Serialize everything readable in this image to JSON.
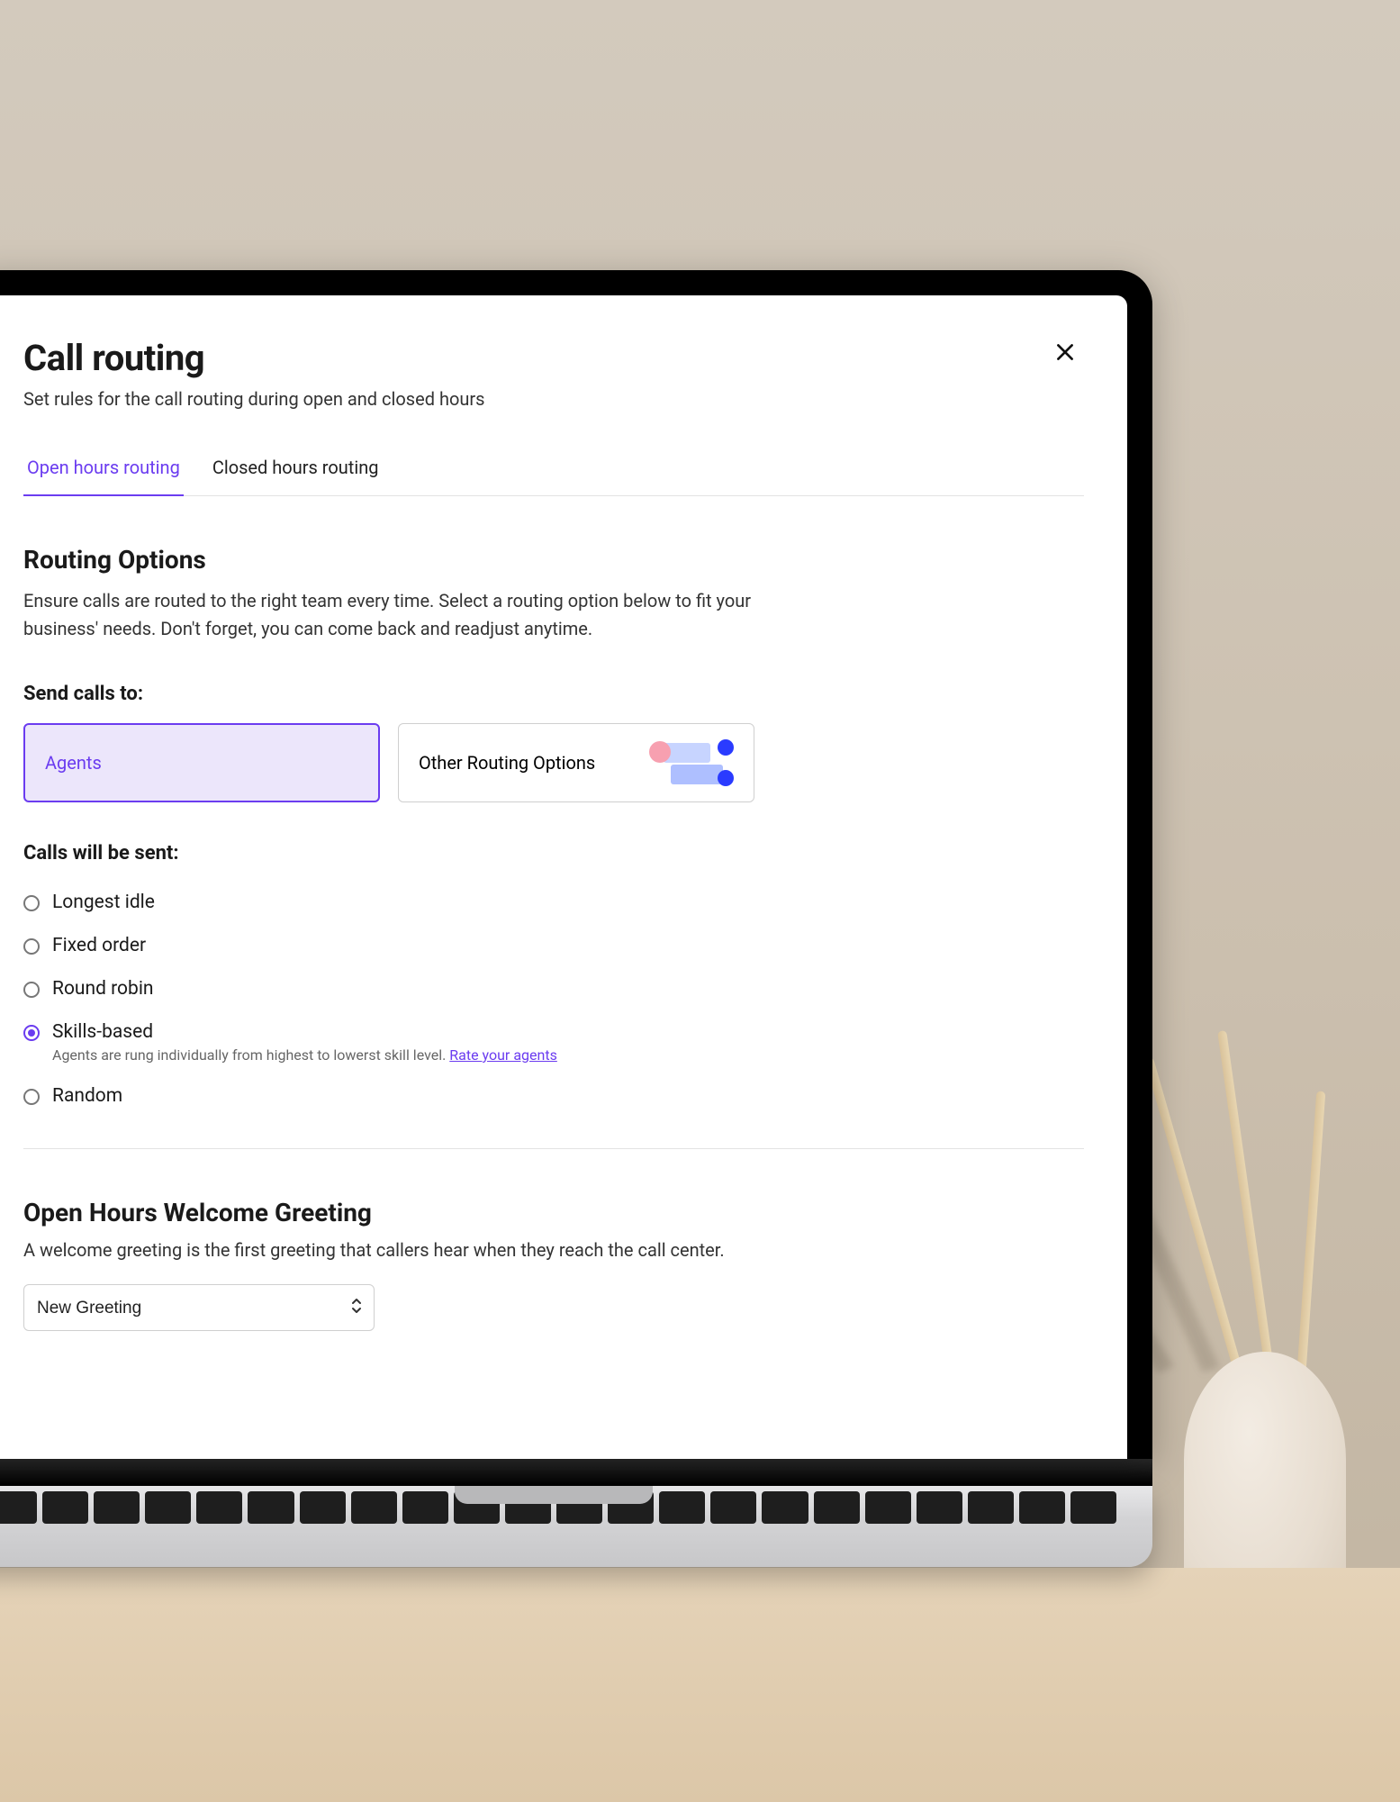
{
  "header": {
    "title": "Call routing",
    "subtitle": "Set rules for the call routing during open and closed hours"
  },
  "tabs": {
    "open": "Open hours routing",
    "closed": "Closed hours routing"
  },
  "routing": {
    "title": "Routing Options",
    "description": "Ensure calls are routed to the right team every time. Select a routing option below to fit your business' needs. Don't forget, you can come back and readjust anytime.",
    "send_calls_label": "Send calls to:",
    "options": {
      "agents": "Agents",
      "other": "Other Routing Options"
    }
  },
  "send_mode": {
    "label": "Calls will be sent:",
    "longest_idle": "Longest idle",
    "fixed_order": "Fixed order",
    "round_robin": "Round robin",
    "skills_based": "Skills-based",
    "skills_help": "Agents are rung individually from highest to lowerst skill level. ",
    "skills_link": "Rate your agents",
    "random": "Random"
  },
  "greeting": {
    "title": "Open Hours Welcome Greeting",
    "description": "A welcome greeting is the first greeting that callers hear when they reach the call center.",
    "selected": "New Greeting"
  }
}
